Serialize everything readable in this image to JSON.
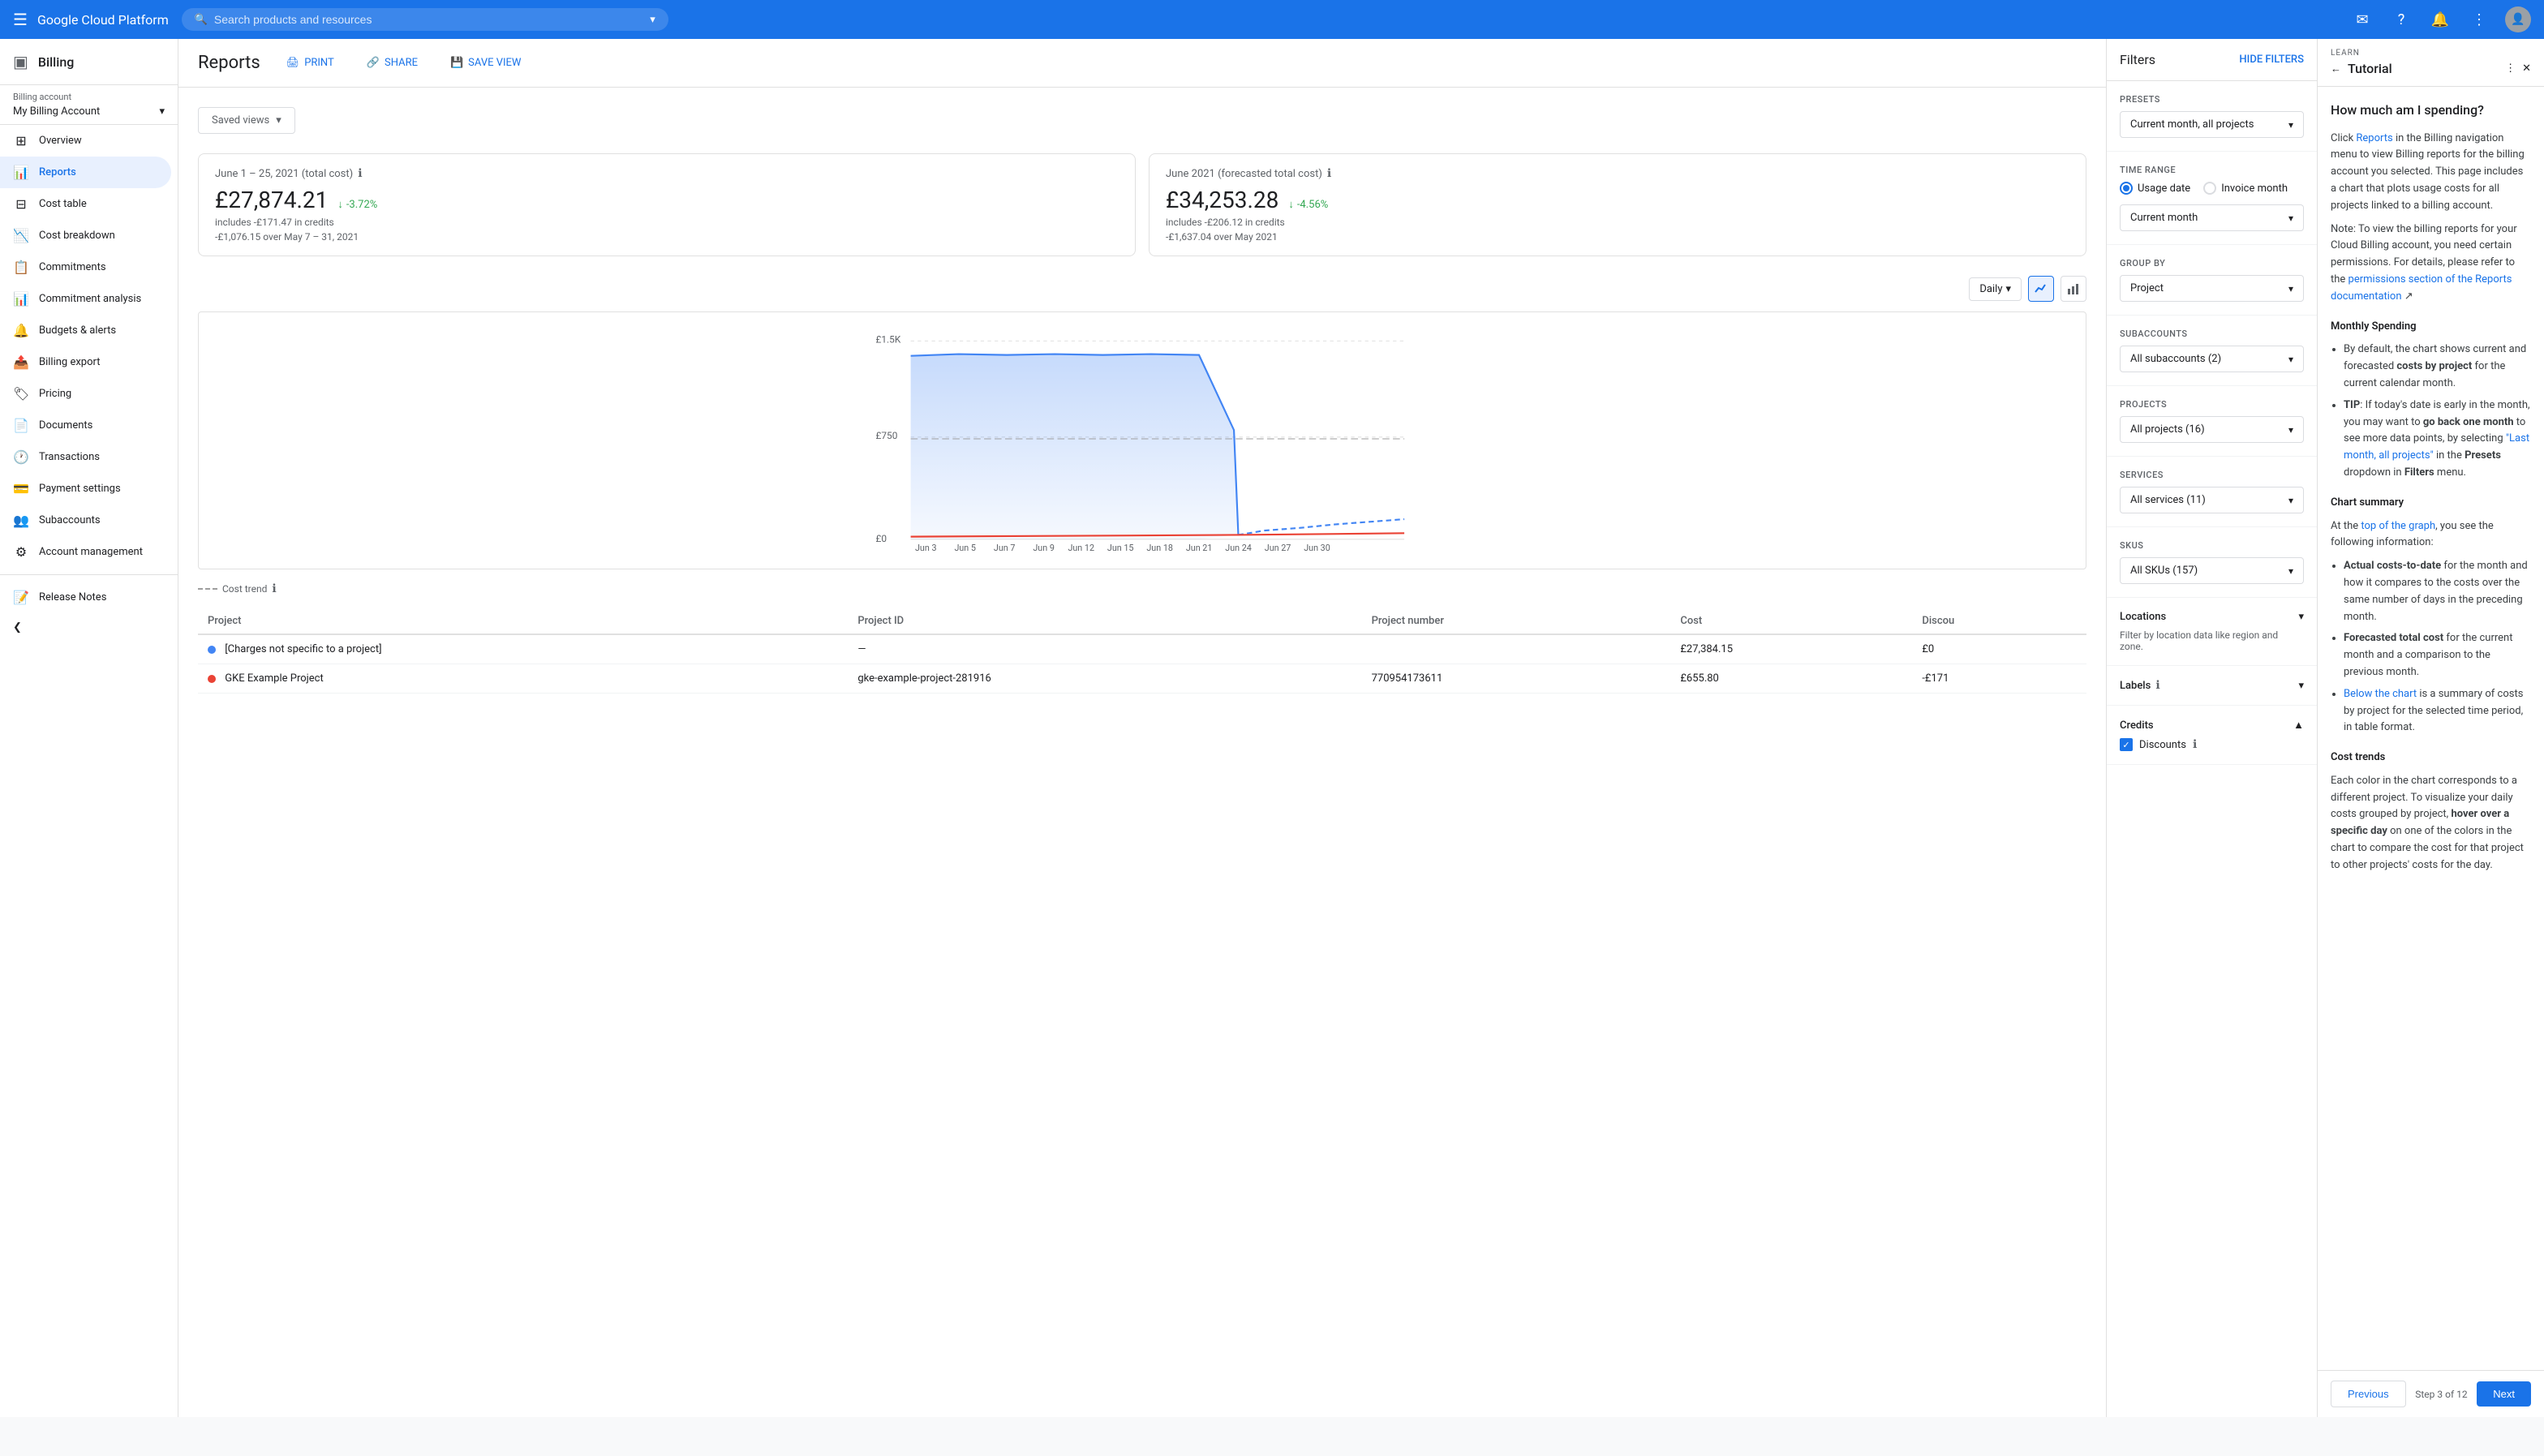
{
  "topNav": {
    "brand": "Google Cloud Platform",
    "searchPlaceholder": "Search products and resources"
  },
  "sidebar": {
    "billing_icon": "▣",
    "billing_title": "Billing",
    "billing_account_label": "Billing account",
    "billing_account_name": "My Billing Account",
    "nav_items": [
      {
        "id": "overview",
        "label": "Overview",
        "icon": "⊞"
      },
      {
        "id": "reports",
        "label": "Reports",
        "icon": "📊",
        "active": true
      },
      {
        "id": "cost-table",
        "label": "Cost table",
        "icon": "⊟"
      },
      {
        "id": "cost-breakdown",
        "label": "Cost breakdown",
        "icon": "📉"
      },
      {
        "id": "commitments",
        "label": "Commitments",
        "icon": "📋"
      },
      {
        "id": "commitment-analysis",
        "label": "Commitment analysis",
        "icon": "📊"
      },
      {
        "id": "budgets-alerts",
        "label": "Budgets & alerts",
        "icon": "🔔"
      },
      {
        "id": "billing-export",
        "label": "Billing export",
        "icon": "📤"
      },
      {
        "id": "pricing",
        "label": "Pricing",
        "icon": "🏷"
      },
      {
        "id": "documents",
        "label": "Documents",
        "icon": "📄"
      },
      {
        "id": "transactions",
        "label": "Transactions",
        "icon": "🕐"
      },
      {
        "id": "payment-settings",
        "label": "Payment settings",
        "icon": "💳"
      },
      {
        "id": "subaccounts",
        "label": "Subaccounts",
        "icon": "👥"
      },
      {
        "id": "account-management",
        "label": "Account management",
        "icon": "⚙"
      }
    ],
    "release_notes": "Release Notes",
    "collapse_label": "❮"
  },
  "reports": {
    "title": "Reports",
    "print_label": "PRINT",
    "share_label": "SHARE",
    "save_view_label": "SAVE VIEW",
    "saved_views_label": "Saved views",
    "period1_title": "June 1 – 25, 2021 (total cost)",
    "period1_amount": "£27,874.21",
    "period1_change": "-3.72%",
    "period1_sub1": "includes -£171.47 in credits",
    "period1_sub2": "-£1,076.15 over May 7 – 31, 2021",
    "period2_title": "June 2021 (forecasted total cost)",
    "period2_amount": "£34,253.28",
    "period2_change": "-4.56%",
    "period2_sub1": "includes -£206.12 in credits",
    "period2_sub2": "-£1,637.04 over May 2021",
    "chart_interval": "Daily",
    "cost_trend_label": "Cost trend",
    "x_axis": [
      "Jun 3",
      "Jun 5",
      "Jun 7",
      "Jun 9",
      "Jun 12",
      "Jun 15",
      "Jun 18",
      "Jun 21",
      "Jun 24",
      "Jun 27",
      "Jun 30"
    ],
    "y_axis": [
      "£0",
      "£750",
      "£1.5K"
    ],
    "table_headers": [
      "Project",
      "Project ID",
      "Project number",
      "Cost",
      "Discou"
    ],
    "table_rows": [
      {
        "dot_color": "#4285f4",
        "project": "[Charges not specific to a project]",
        "project_id": "—",
        "project_number": "",
        "cost": "£27,384.15",
        "discount": "£0"
      },
      {
        "dot_color": "#ea4335",
        "project": "GKE Example Project",
        "project_id": "gke-example-project-281916",
        "project_number": "770954173611",
        "cost": "£655.80",
        "discount": "-£171"
      }
    ]
  },
  "filters": {
    "title": "Filters",
    "hide_filters": "HIDE FILTERS",
    "presets_label": "Presets",
    "presets_value": "Current month, all projects",
    "time_range_label": "Time range",
    "usage_date_label": "Usage date",
    "invoice_month_label": "Invoice month",
    "current_month_label": "Current month",
    "group_by_label": "Group by",
    "group_by_value": "Project",
    "subaccounts_label": "Subaccounts",
    "subaccounts_value": "All subaccounts (2)",
    "projects_label": "Projects",
    "projects_value": "All projects (16)",
    "services_label": "Services",
    "services_value": "All services (11)",
    "skus_label": "SKUs",
    "skus_value": "All SKUs (157)",
    "locations_label": "Locations",
    "locations_sub": "Filter by location data like region and zone.",
    "labels_label": "Labels",
    "credits_label": "Credits",
    "discounts_label": "Discounts"
  },
  "tutorial": {
    "learn_label": "LEARN",
    "title": "Tutorial",
    "main_heading": "How much am I spending?",
    "intro_text": "Click Reports in the Billing navigation menu to view Billing reports for the billing account you selected. This page includes a chart that plots usage costs for all projects linked to a billing account.",
    "note_text": "Note: To view the billing reports for your Cloud Billing account, you need certain permissions. For details, please refer to the permissions section of the Reports documentation",
    "monthly_heading": "Monthly Spending",
    "monthly_items": [
      "By default, the chart shows current and forecasted costs by project for the current calendar month.",
      "TIP: If today's date is early in the month, you may want to go back one month to see more data points, by selecting \"Last month, all projects\" in the Presets dropdown in Filters menu."
    ],
    "chart_summary_heading": "Chart summary",
    "chart_summary_text": "At the top of the graph, you see the following information:",
    "chart_summary_items": [
      "Actual costs-to-date for the month and how it compares to the costs over the same number of days in the preceding month.",
      "Forecasted total cost for the current month and a comparison to the previous month.",
      "Below the chart is a summary of costs by project for the selected time period, in table format."
    ],
    "cost_trends_heading": "Cost trends",
    "cost_trends_text": "Each color in the chart corresponds to a different project. To visualize your daily costs grouped by project, hover over a specific day on one of the colors in the chart to compare the cost for that project to other projects' costs for the day.",
    "prev_label": "Previous",
    "step_label": "Step 3 of 12",
    "next_label": "Next"
  }
}
